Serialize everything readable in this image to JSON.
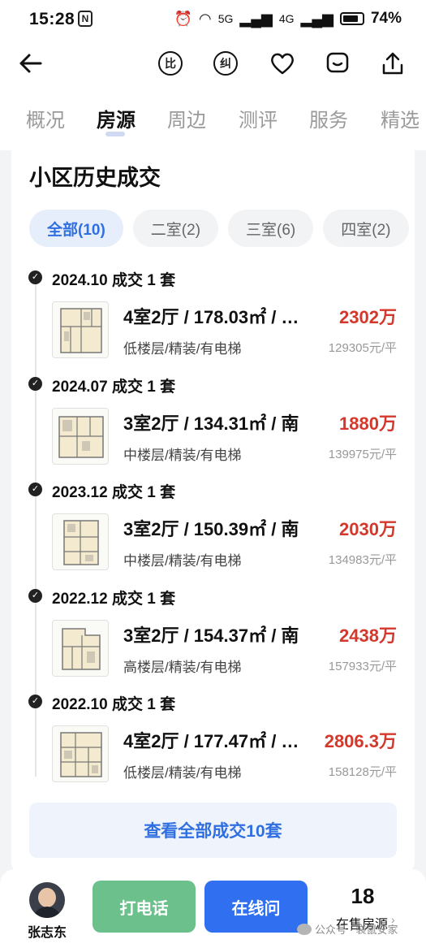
{
  "status_bar": {
    "time": "15:28",
    "nfc": "N",
    "network_5g": "5G",
    "network_4g": "4G",
    "battery_pct": "74%"
  },
  "nav": {
    "back_icon": "arrow-left-icon",
    "compare_char": "比",
    "correct_char": "纠",
    "icons": [
      "compare-icon",
      "correction-icon",
      "heart-icon",
      "message-icon",
      "share-icon"
    ]
  },
  "tabs": [
    {
      "label": "概况"
    },
    {
      "label": "房源"
    },
    {
      "label": "周边"
    },
    {
      "label": "测评"
    },
    {
      "label": "服务"
    },
    {
      "label": "精选"
    }
  ],
  "section": {
    "title": "小区历史成交"
  },
  "filters": [
    {
      "label": "全部(10)"
    },
    {
      "label": "二室(2)"
    },
    {
      "label": "三室(6)"
    },
    {
      "label": "四室(2)"
    }
  ],
  "records": [
    {
      "date": "2024.10 成交 1 套",
      "spec": "4室2厅 / 178.03㎡ / …",
      "attrs": "低楼层/精装/有电梯",
      "price": "2302万",
      "unit_price": "129305元/平"
    },
    {
      "date": "2024.07 成交 1 套",
      "spec": "3室2厅 / 134.31㎡ / 南",
      "attrs": "中楼层/精装/有电梯",
      "price": "1880万",
      "unit_price": "139975元/平"
    },
    {
      "date": "2023.12 成交 1 套",
      "spec": "3室2厅 / 150.39㎡ / 南",
      "attrs": "中楼层/精装/有电梯",
      "price": "2030万",
      "unit_price": "134983元/平"
    },
    {
      "date": "2022.12 成交 1 套",
      "spec": "3室2厅 / 154.37㎡ / 南",
      "attrs": "高楼层/精装/有电梯",
      "price": "2438万",
      "unit_price": "157933元/平"
    },
    {
      "date": "2022.10 成交 1 套",
      "spec": "4室2厅 / 177.47㎡ / …",
      "attrs": "低楼层/精装/有电梯",
      "price": "2806.3万",
      "unit_price": "158128元/平"
    }
  ],
  "view_all": {
    "label": "查看全部成交10套"
  },
  "bottom_bar": {
    "agent_name": "张志东",
    "call_label": "打电话",
    "chat_label": "在线问",
    "for_sale_count": "18",
    "for_sale_label": "在售房源"
  },
  "watermark": {
    "text": "公众号 · 袋鼠安家"
  },
  "colors": {
    "accent": "#2f6fe0",
    "price_red": "#d4382c",
    "call_green": "#6cc08b",
    "chat_blue": "#2f6ff0"
  }
}
